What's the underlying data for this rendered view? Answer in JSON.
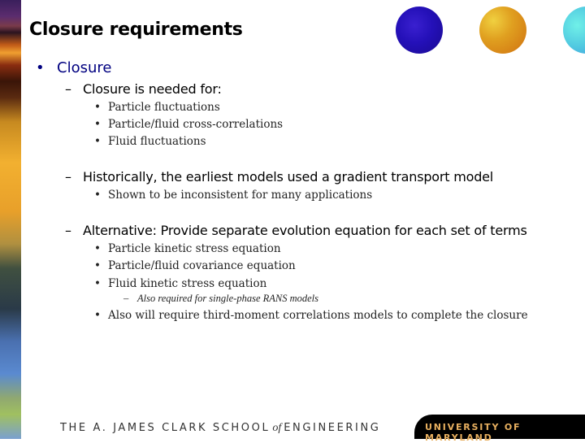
{
  "slide": {
    "title": "Closure requirements",
    "level1": {
      "bullet": "•",
      "text": "Closure"
    },
    "sections": [
      {
        "dash": "–",
        "text": "Closure is needed for:",
        "items": [
          "Particle fluctuations",
          "Particle/fluid cross-correlations",
          "Fluid fluctuations"
        ]
      },
      {
        "dash": "–",
        "text": "Historically, the earliest models used a gradient transport model",
        "items": [
          "Shown to be inconsistent for many applications"
        ]
      },
      {
        "dash": "–",
        "text": "Alternative: Provide separate evolution equation for each set of terms",
        "items": [
          "Particle kinetic stress equation",
          "Particle/fluid covariance equation",
          "Fluid kinetic stress equation"
        ],
        "subnote": {
          "dash": "–",
          "text": "Also required for single-phase RANS models"
        },
        "last_item": "Also will require third-moment correlations models to complete the closure"
      }
    ],
    "bullet_glyph": "•"
  },
  "footer": {
    "school_prefix": "THE A. JAMES CLARK SCHOOL",
    "school_of": "of",
    "school_suffix": "ENGINEERING",
    "university": "UNIVERSITY OF MARYLAND"
  },
  "decorations": {
    "spheres": [
      "blue-sphere",
      "orange-sphere",
      "cyan-sphere"
    ]
  }
}
